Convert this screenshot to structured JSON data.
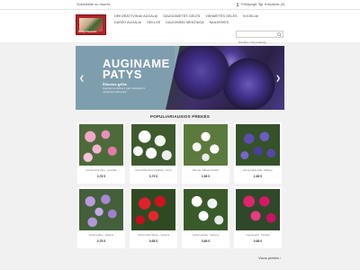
{
  "topbar": {
    "contact": "Susisiekite su mumis",
    "signin": "Prisijungti",
    "cart": "Krepšelis (0)"
  },
  "logo": {
    "text": "Gėlių Pasaulis"
  },
  "nav": {
    "row1": [
      "DEKORATYVINIAI AUGALAI",
      "DAUGIAMETĖS GĖLĖS",
      "VIENMETĖS GĖLĖS",
      "VIJOKLIAI"
    ],
    "row2": [
      "DARŽO AUGALAI",
      "SĖKLOS",
      "DAUGINIMO MEDŽIAGA",
      "NAUJIENOS"
    ]
  },
  "search": {
    "placeholder": "Paieška mūsų kataloge"
  },
  "slider": {
    "title_line1": "AUGINAME",
    "title_line2": "PATYS",
    "subtitle": "Šilumos gėlės",
    "desc": "Auginame pačios ir gali užsisakyti ir naujausiai dėmesiui..."
  },
  "section_title": "POPULIARIAUSIOS PREKĖS",
  "products": [
    {
      "name": "Armeria Pink Tiara - Gvazdikė",
      "price": "0,78 €"
    },
    {
      "name": "Iberis White Dwarf Tabletop - Iberis",
      "price": "0,79 €"
    },
    {
      "name": "Bacopa - Bakopa Double",
      "price": "1,68 €"
    },
    {
      "name": "Bacopa Blue Falls - Bakopa",
      "price": "1,68 €"
    },
    {
      "name": "Verbena Blue - Verbena",
      "price": "0,78 €"
    },
    {
      "name": "Verbena Red Tapien - Verbena",
      "price": "0,68 €"
    },
    {
      "name": "Verbena White - Verbena",
      "price": "0,68 €"
    },
    {
      "name": "Petunia Pink - Petunija",
      "price": "0,68 €"
    }
  ],
  "more_label": "Visos prekės",
  "colors": {
    "accent_red": "#b3222a",
    "slider_panel": "#7e9eae"
  }
}
